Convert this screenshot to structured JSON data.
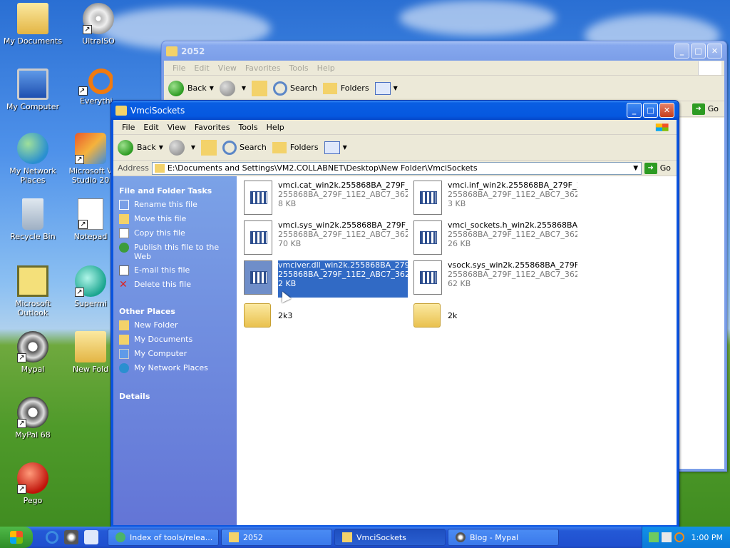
{
  "desktop": {
    "icons": [
      {
        "label": "My Documents"
      },
      {
        "label": "UltraISO"
      },
      {
        "label": "My Computer"
      },
      {
        "label": "Everythi"
      },
      {
        "label": "My Network Places"
      },
      {
        "label": "Microsoft V Studio 20"
      },
      {
        "label": "Recycle Bin"
      },
      {
        "label": "Notepad"
      },
      {
        "label": "Microsoft Outlook"
      },
      {
        "label": "Supermi"
      },
      {
        "label": "Mypal"
      },
      {
        "label": "New Fold"
      },
      {
        "label": "MyPal 68"
      },
      {
        "label": "Pego"
      }
    ]
  },
  "back_window": {
    "title": "2052",
    "menu": [
      "File",
      "Edit",
      "View",
      "Favorites",
      "Tools",
      "Help"
    ],
    "back_label": "Back",
    "search_label": "Search",
    "folders_label": "Folders",
    "go_label": "Go"
  },
  "front_window": {
    "title": "VmciSockets",
    "menu": [
      "File",
      "Edit",
      "View",
      "Favorites",
      "Tools",
      "Help"
    ],
    "back_label": "Back",
    "search_label": "Search",
    "folders_label": "Folders",
    "address_label": "Address",
    "address_value": "E:\\Documents and Settings\\VM2.COLLABNET\\Desktop\\New Folder\\VmciSockets",
    "go_label": "Go"
  },
  "tasks": {
    "file_tasks_header": "File and Folder Tasks",
    "file_tasks": [
      "Rename this file",
      "Move this file",
      "Copy this file",
      "Publish this file to the Web",
      "E-mail this file",
      "Delete this file"
    ],
    "other_places_header": "Other Places",
    "other_places": [
      "New Folder",
      "My Documents",
      "My Computer",
      "My Network Places"
    ],
    "details_header": "Details"
  },
  "files": [
    {
      "name": "vmci.cat_win2k.255868BA_279F_1...",
      "sub": "255868BA_279F_11E2_ABC7_362...",
      "size": "8 KB"
    },
    {
      "name": "vmci.inf_win2k.255868BA_279F_1...",
      "sub": "255868BA_279F_11E2_ABC7_362...",
      "size": "3 KB"
    },
    {
      "name": "vmci.sys_win2k.255868BA_279F_1...",
      "sub": "255868BA_279F_11E2_ABC7_362...",
      "size": "70 KB"
    },
    {
      "name": "vmci_sockets.h_win2k.255868BA_...",
      "sub": "255868BA_279F_11E2_ABC7_362...",
      "size": "26 KB"
    },
    {
      "name": "vmciver.dll_win2k.255868BA_279...",
      "sub": "255868BA_279F_11E2_ABC7_362...",
      "size": "2 KB"
    },
    {
      "name": "vsock.sys_win2k.255868BA_279F_...",
      "sub": "255868BA_279F_11E2_ABC7_362...",
      "size": "62 KB"
    }
  ],
  "folders": [
    {
      "name": "2k3"
    },
    {
      "name": "2k"
    }
  ],
  "taskbar": {
    "tasks": [
      {
        "label": "Index of tools/relea..."
      },
      {
        "label": "2052"
      },
      {
        "label": "VmciSockets"
      },
      {
        "label": "Blog - Mypal"
      }
    ],
    "clock": "1:00 PM"
  }
}
